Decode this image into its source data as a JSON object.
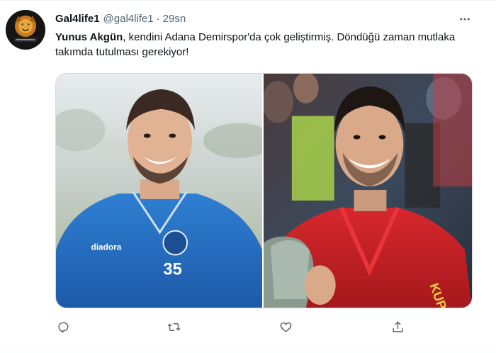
{
  "tweet": {
    "author_name": "Gal4life1",
    "author_handle": "@gal4life1",
    "separator": "·",
    "timestamp": "29sn",
    "text_mention": "Yunus Akgün",
    "text_body": ", kendini Adana Demirspor'da çok geliştirmiş. Döndüğü zaman mutlaka takımda tutulması gerekiyor!",
    "avatar_icon": "lion-logo-icon",
    "media": [
      {
        "icon": "player-photo-blue-kit"
      },
      {
        "icon": "player-photo-red-kit-trophy"
      }
    ],
    "actions": [
      {
        "icon": "reply-icon"
      },
      {
        "icon": "retweet-icon"
      },
      {
        "icon": "like-icon"
      },
      {
        "icon": "share-icon"
      }
    ]
  },
  "colors": {
    "text_primary": "#0f1419",
    "text_secondary": "#536471",
    "border": "#cfd9de"
  }
}
